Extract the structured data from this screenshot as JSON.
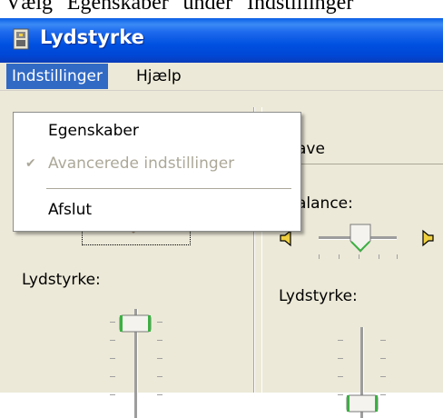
{
  "doc_caption": "Vælg \"Egenskaber\" under \"Indstillinger\"",
  "window": {
    "title": "Lydstyrke"
  },
  "menubar": {
    "items": [
      "Indstillinger",
      "Hjælp"
    ]
  },
  "dropdown": {
    "items": [
      {
        "label": "Egenskaber",
        "enabled": true,
        "checked": false
      },
      {
        "label": "Avancerede indstillinger",
        "enabled": false,
        "checked": true
      },
      {
        "label": "Afslut",
        "enabled": true,
        "checked": false
      }
    ]
  },
  "left_panel": {
    "volume_label": "Lydstyrke:"
  },
  "right_panel": {
    "header_partial": "ave",
    "balance_label": "alance:",
    "volume_label": "Lydstyrke:"
  },
  "colors": {
    "titlebar": "#0050e0",
    "menu_highlight": "#316ac5",
    "background": "#ece9d8",
    "thumb_green": "#3cb043"
  }
}
